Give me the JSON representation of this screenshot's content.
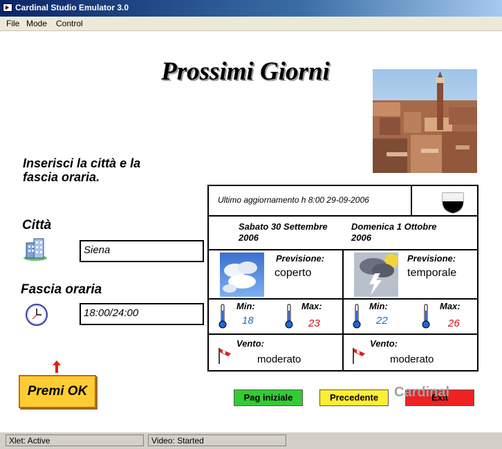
{
  "window": {
    "title": "Cardinal Studio Emulator 3.0"
  },
  "menu": {
    "items": [
      "File",
      "Mode",
      "Control"
    ]
  },
  "page": {
    "title": "Prossimi Giorni",
    "instructions_line1": "Inserisci la città e la",
    "instructions_line2": "fascia  oraria.",
    "city_label": "Città",
    "city_value": "Siena",
    "time_label": "Fascia oraria",
    "time_value": "18:00/24:00",
    "ok_button": "Premi OK"
  },
  "forecast": {
    "last_update": "Ultimo aggiornamento h 8:00 29-09-2006",
    "days": [
      {
        "date_line1": "Sabato 30 Settembre",
        "date_line2": "2006",
        "forecast_label": "Previsione:",
        "forecast_value": "coperto",
        "min_label": "Min:",
        "min_value": "18",
        "max_label": "Max:",
        "max_value": "23",
        "wind_label": "Vento:",
        "wind_value": "moderato"
      },
      {
        "date_line1": "Domenica 1 Ottobre",
        "date_line2": "2006",
        "forecast_label": "Previsione:",
        "forecast_value": "temporale",
        "min_label": "Min:",
        "min_value": "22",
        "max_label": "Max:",
        "max_value": "26",
        "wind_label": "Vento:",
        "wind_value": "moderato"
      }
    ]
  },
  "nav": {
    "home": "Pag iniziale",
    "prev": "Precedente",
    "exit": "Exit"
  },
  "brand": "Cardinal",
  "status": {
    "xlet": "Xlet: Active",
    "video": "Video: Started"
  },
  "colors": {
    "min_temp": "#1a6fc4",
    "max_temp": "#cc1111",
    "home_btn": "#33cc33",
    "prev_btn": "#ffee33",
    "exit_btn": "#ee2222"
  }
}
